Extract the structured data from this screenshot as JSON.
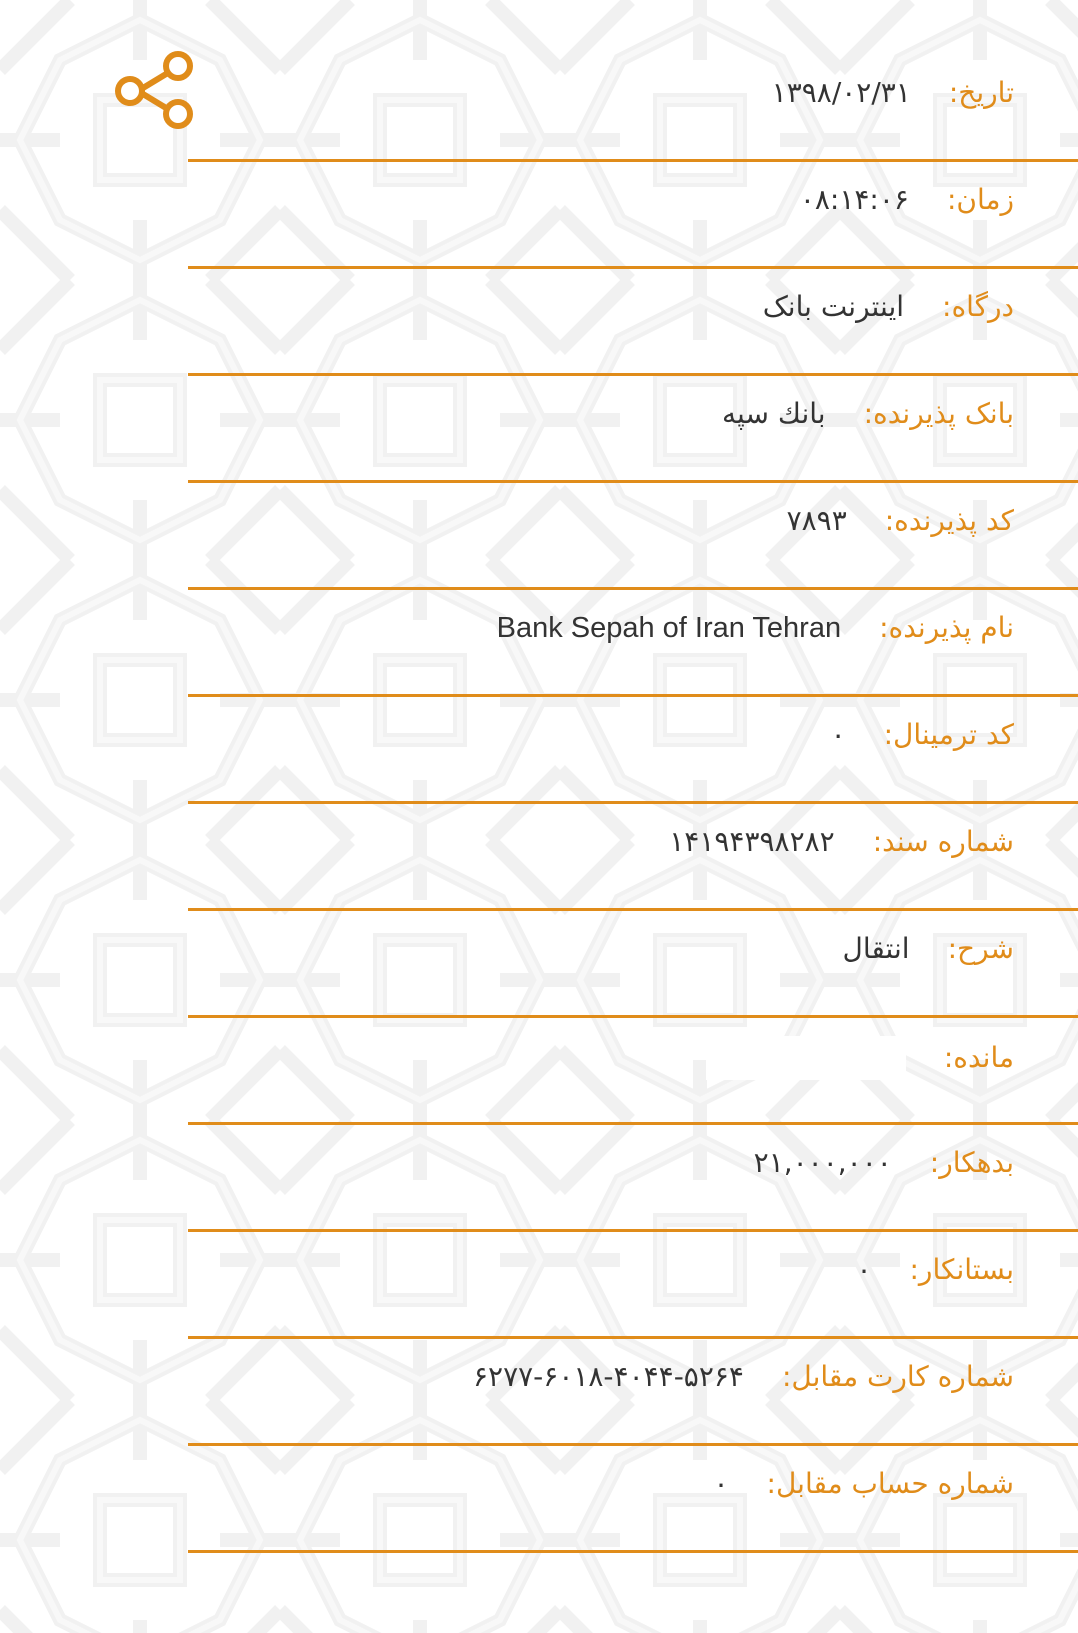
{
  "toolbar": {
    "share_icon": "share-icon",
    "accent_color": "#e08c1a"
  },
  "receipt": {
    "rows": [
      {
        "label": "تاریخ:",
        "value": "۱۳۹۸/۰۲/۳۱"
      },
      {
        "label": "زمان:",
        "value": "۰۸:۱۴:۰۶"
      },
      {
        "label": "درگاه:",
        "value": "اینترنت بانک"
      },
      {
        "label": "بانک پذیرنده:",
        "value": "بانك سپه"
      },
      {
        "label": "کد پذیرنده:",
        "value": "۷۸۹۳"
      },
      {
        "label": "نام پذیرنده:",
        "value": "Bank Sepah of Iran Tehran"
      },
      {
        "label": "کد ترمینال:",
        "value": "۰"
      },
      {
        "label": "شماره سند:",
        "value": "۱۴۱۹۴۳۹۸۲۸۲"
      },
      {
        "label": "شرح:",
        "value": "انتقال"
      },
      {
        "label": "مانده:",
        "value": ""
      },
      {
        "label": "بدهکار:",
        "value": "۲۱,۰۰۰,۰۰۰"
      },
      {
        "label": "بستانکار:",
        "value": "۰"
      },
      {
        "label": "شماره کارت مقابل:",
        "value": "۶۲۷۷-۶۰۱۸-۴۰۴۴-۵۲۶۴"
      },
      {
        "label": "شماره حساب مقابل:",
        "value": "۰"
      }
    ]
  }
}
